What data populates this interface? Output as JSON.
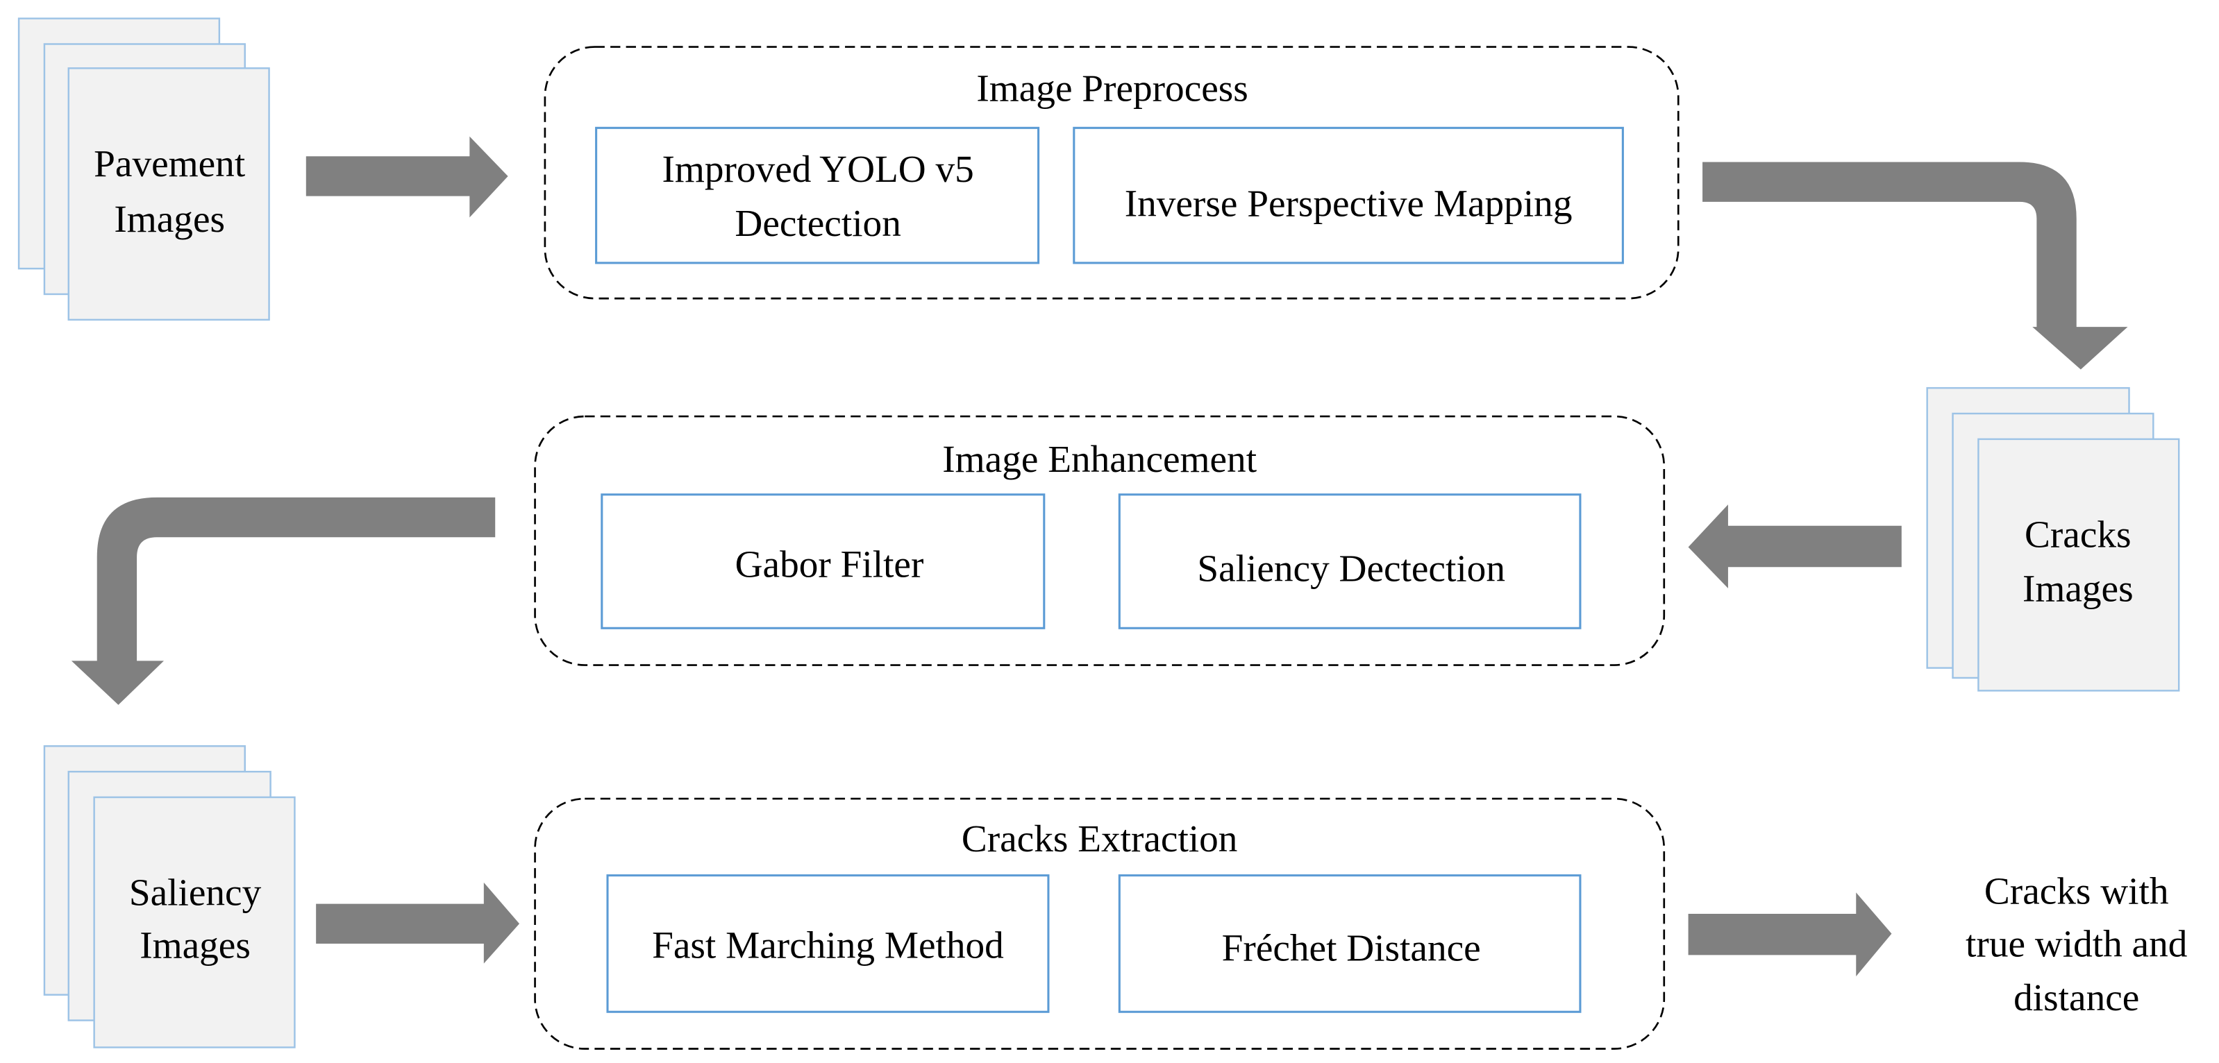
{
  "inputs": {
    "pavement_images": [
      "Pavement",
      "Images"
    ],
    "cracks_images": [
      "Cracks",
      "Images"
    ],
    "saliency_images": [
      "Saliency",
      "Images"
    ]
  },
  "stages": [
    {
      "title": "Image Preprocess",
      "steps": [
        [
          "Improved YOLO v5",
          "Dectection"
        ],
        [
          "Inverse Perspective Mapping"
        ]
      ]
    },
    {
      "title": "Image Enhancement",
      "steps": [
        [
          "Gabor Filter"
        ],
        [
          "Saliency Dectection"
        ]
      ]
    },
    {
      "title": "Cracks Extraction",
      "steps": [
        [
          "Fast Marching Method"
        ],
        [
          "Fréchet Distance"
        ]
      ]
    }
  ],
  "output": [
    "Cracks with",
    "true width and",
    "distance"
  ],
  "colors": {
    "arrow": "#808080",
    "sheet_fill": "#f2f2f2",
    "sheet_border": "#9dc3e6",
    "step_border": "#5b9bd5"
  }
}
